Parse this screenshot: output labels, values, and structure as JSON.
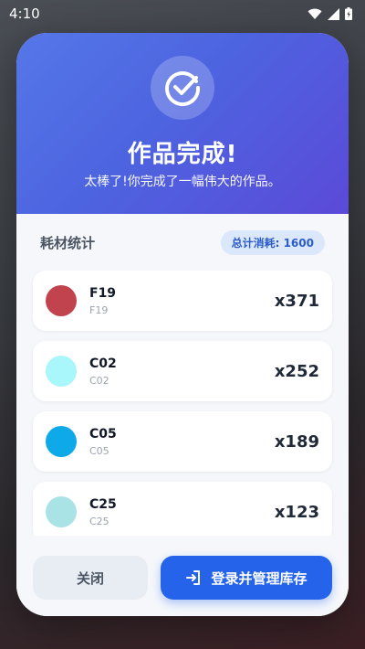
{
  "status": {
    "time": "4:10"
  },
  "hero": {
    "title": "作品完成!",
    "subtitle": "太棒了!你完成了一幅伟大的作品。"
  },
  "stats": {
    "section_title": "耗材统计",
    "total_label": "总计消耗: 1600"
  },
  "items": [
    {
      "code": "F19",
      "subcode": "F19",
      "qty": "x371",
      "color": "#c0434d"
    },
    {
      "code": "C02",
      "subcode": "C02",
      "qty": "x252",
      "color": "#a9f6fb"
    },
    {
      "code": "C05",
      "subcode": "C05",
      "qty": "x189",
      "color": "#0ea9e9"
    },
    {
      "code": "C25",
      "subcode": "C25",
      "qty": "x123",
      "color": "#a9e3e6"
    }
  ],
  "actions": {
    "close_label": "关闭",
    "primary_label": "登录并管理库存"
  },
  "icons": {
    "hero": "check-circle-icon",
    "login": "login-icon"
  },
  "colors": {
    "accent": "#2563eb",
    "hero_start": "#5577e8",
    "hero_end": "#5b4ad8"
  }
}
